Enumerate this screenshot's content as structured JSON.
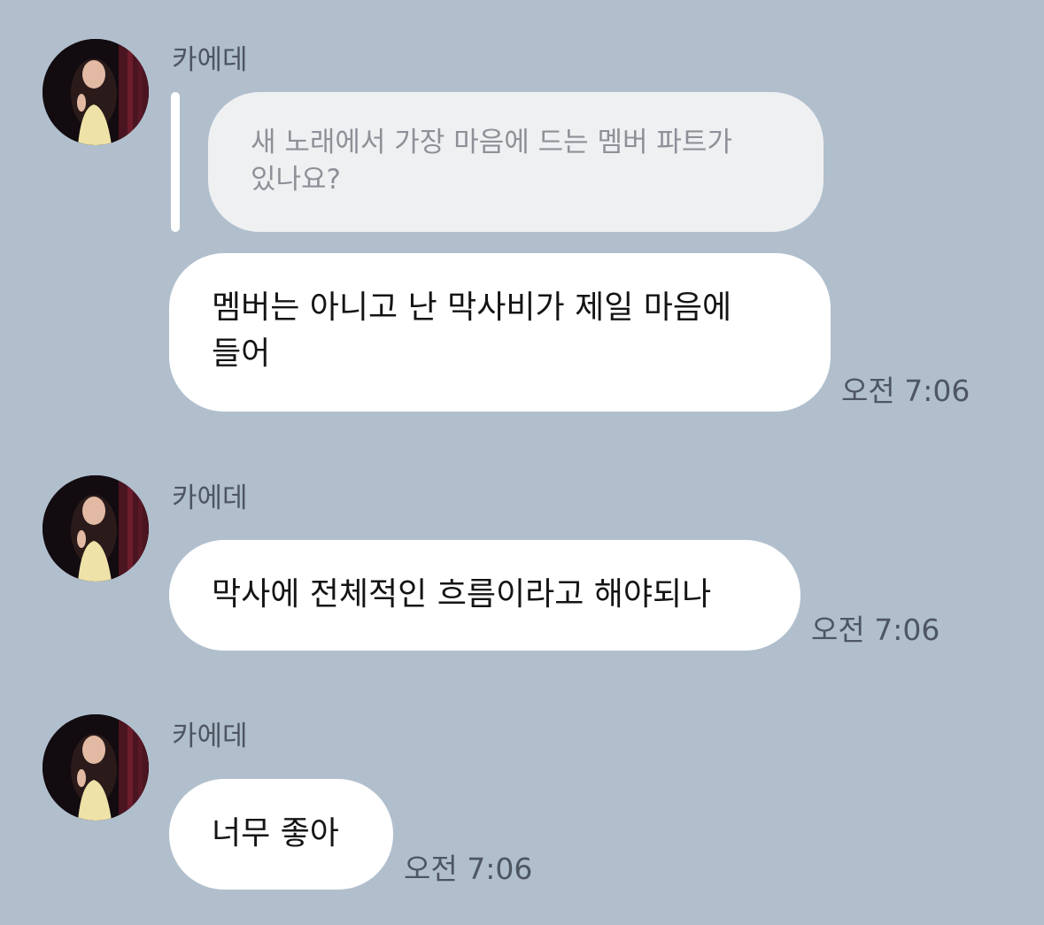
{
  "chat": {
    "messages": [
      {
        "sender": "카에데",
        "reply_to": "새 노래에서 가장 마음에 드는 멤버 파트가 있나요?",
        "reply_lines": [
          "새 노래에서 가장 마음에 드는 멤버 파트가",
          "있나요?"
        ],
        "lines": [
          "멤버는 아니고 난 막사비가 제일 마음에",
          "들어"
        ],
        "time": "오전 7:06"
      },
      {
        "sender": "카에데",
        "lines": [
          "막사에 전체적인 흐름이라고 해야되나"
        ],
        "time": "오전 7:06"
      },
      {
        "sender": "카에데",
        "lines": [
          "너무 좋아"
        ],
        "time": "오전 7:06"
      }
    ]
  },
  "colors": {
    "background": "#b1bfcd",
    "bubble": "#ffffff",
    "quote_bubble": "#eff0f2",
    "quote_text": "#8d9197",
    "meta_text": "#4d5661"
  }
}
